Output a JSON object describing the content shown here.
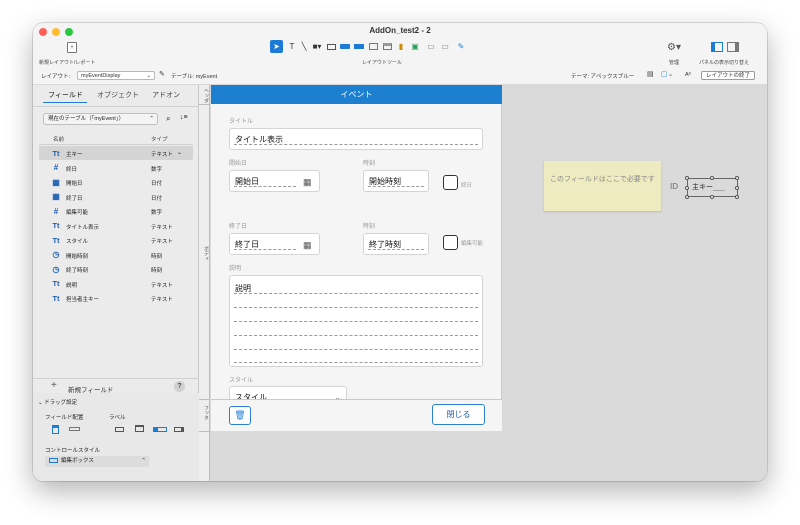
{
  "window": {
    "title": "AddOn_test2 - 2"
  },
  "toolbar": {
    "new_layout_label": "新規レイアウト/レポート",
    "layout_tools_label": "レイアウトツール",
    "manage_label": "管理",
    "panel_toggle_label": "パネルの表示切り替え"
  },
  "layoutbar": {
    "layout_label": "レイアウト:",
    "layout_value": "myEventDisplay",
    "table_text": "テーブル: myEvent",
    "theme_text": "テーマ: アペックスブルー",
    "aa_text": "Aª",
    "exit_layout_label": "レイアウトの終了"
  },
  "left_panel": {
    "tabs": [
      "フィールド",
      "オブジェクト",
      "アドオン"
    ],
    "table_select_value": "現在のテーブル（「myEvent」）",
    "col_name": "名前",
    "col_type": "タイプ",
    "fields": [
      {
        "icon": "Tt",
        "name": "主キー",
        "type": "テキスト",
        "selected": true
      },
      {
        "icon": "#",
        "name": "終日",
        "type": "数字"
      },
      {
        "icon": "cal",
        "name": "開始日",
        "type": "日付"
      },
      {
        "icon": "cal",
        "name": "終了日",
        "type": "日付"
      },
      {
        "icon": "#",
        "name": "編集可能",
        "type": "数字"
      },
      {
        "icon": "Tt",
        "name": "タイトル表示",
        "type": "テキスト"
      },
      {
        "icon": "Tt",
        "name": "スタイル",
        "type": "テキスト"
      },
      {
        "icon": "clock",
        "name": "開始時刻",
        "type": "時刻"
      },
      {
        "icon": "clock",
        "name": "終了時刻",
        "type": "時刻"
      },
      {
        "icon": "Tt",
        "name": "説明",
        "type": "テキスト"
      },
      {
        "icon": "Tt",
        "name": "担当者主キー",
        "type": "テキスト"
      }
    ],
    "new_field_label": "新規フィールド",
    "drag_settings_label": "ドラッグ設定",
    "field_placement_label": "フィールド配置",
    "label_label": "ラベル",
    "control_style_label": "コントロールスタイル",
    "control_style_value": "編集ボックス"
  },
  "parts": {
    "header": "ヘッダ",
    "body": "ボディ",
    "footer": "フッタ"
  },
  "form": {
    "header_title": "イベント",
    "title_label": "タイトル",
    "title_value": "タイトル表示",
    "start_date_label": "開始日",
    "start_date_value": "開始日",
    "start_time_label": "時刻",
    "start_time_value": "開始時刻",
    "allday_label": "終日",
    "end_date_label": "終了日",
    "end_date_value": "終了日",
    "end_time_label": "時刻",
    "end_time_value": "終了時刻",
    "editable_label": "編集可能",
    "desc_label": "説明",
    "desc_value": "説明",
    "style_label": "スタイル",
    "style_value": "スタイル",
    "close_button": "閉じる"
  },
  "canvas": {
    "sticky_note": "このフィールドはここで必要です",
    "id_label": "ID",
    "id_field_value": "主キー"
  }
}
